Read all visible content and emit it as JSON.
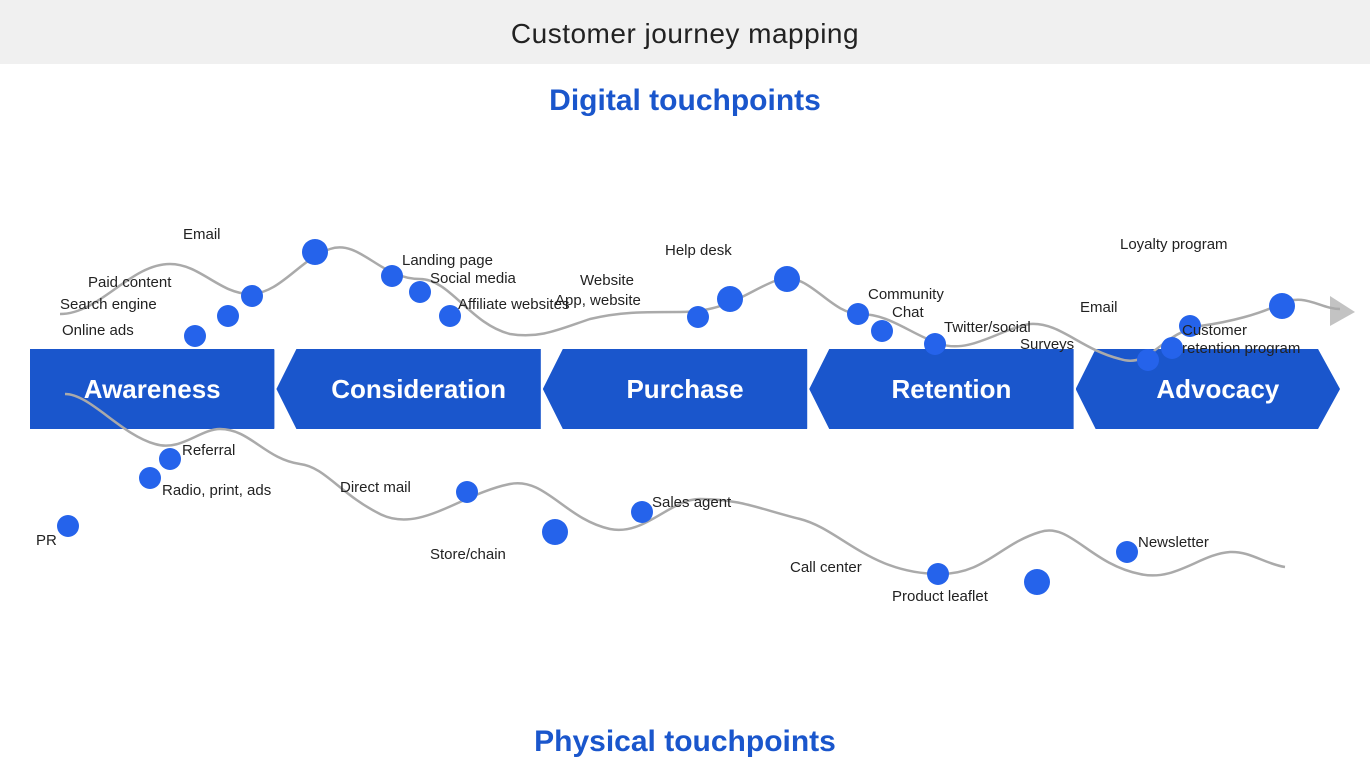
{
  "page": {
    "title": "Customer journey mapping",
    "digital_title": "Digital touchpoints",
    "physical_title": "Physical touchpoints"
  },
  "stages": [
    {
      "label": "Awareness",
      "id": "awareness"
    },
    {
      "label": "Consideration",
      "id": "consideration"
    },
    {
      "label": "Purchase",
      "id": "purchase"
    },
    {
      "label": "Retention",
      "id": "retention"
    },
    {
      "label": "Advocacy",
      "id": "advocacy"
    }
  ],
  "digital_touchpoints": [
    {
      "label": "Online ads",
      "stage": "awareness"
    },
    {
      "label": "Search engine",
      "stage": "awareness"
    },
    {
      "label": "Paid content",
      "stage": "awareness"
    },
    {
      "label": "Email",
      "stage": "awareness"
    },
    {
      "label": "Landing page",
      "stage": "consideration"
    },
    {
      "label": "Social media",
      "stage": "consideration"
    },
    {
      "label": "Affiliate websites",
      "stage": "consideration"
    },
    {
      "label": "App, website",
      "stage": "purchase"
    },
    {
      "label": "Website",
      "stage": "purchase"
    },
    {
      "label": "Help desk",
      "stage": "retention"
    },
    {
      "label": "Community",
      "stage": "retention"
    },
    {
      "label": "Chat",
      "stage": "retention"
    },
    {
      "label": "Twitter/social",
      "stage": "retention"
    },
    {
      "label": "Email",
      "stage": "advocacy"
    },
    {
      "label": "Customer retention program",
      "stage": "advocacy"
    },
    {
      "label": "Surveys",
      "stage": "advocacy"
    },
    {
      "label": "Loyalty program",
      "stage": "advocacy"
    }
  ],
  "physical_touchpoints": [
    {
      "label": "PR",
      "stage": "awareness"
    },
    {
      "label": "Radio, print, ads",
      "stage": "awareness"
    },
    {
      "label": "Referral",
      "stage": "awareness"
    },
    {
      "label": "Direct mail",
      "stage": "consideration"
    },
    {
      "label": "Store/chain",
      "stage": "purchase"
    },
    {
      "label": "Sales agent",
      "stage": "purchase"
    },
    {
      "label": "Call center",
      "stage": "retention"
    },
    {
      "label": "Product leaflet",
      "stage": "retention"
    },
    {
      "label": "Newsletter",
      "stage": "advocacy"
    }
  ],
  "colors": {
    "band_blue": "#1a56cc",
    "dot_blue": "#2563eb",
    "title_blue": "#1a56cc"
  }
}
